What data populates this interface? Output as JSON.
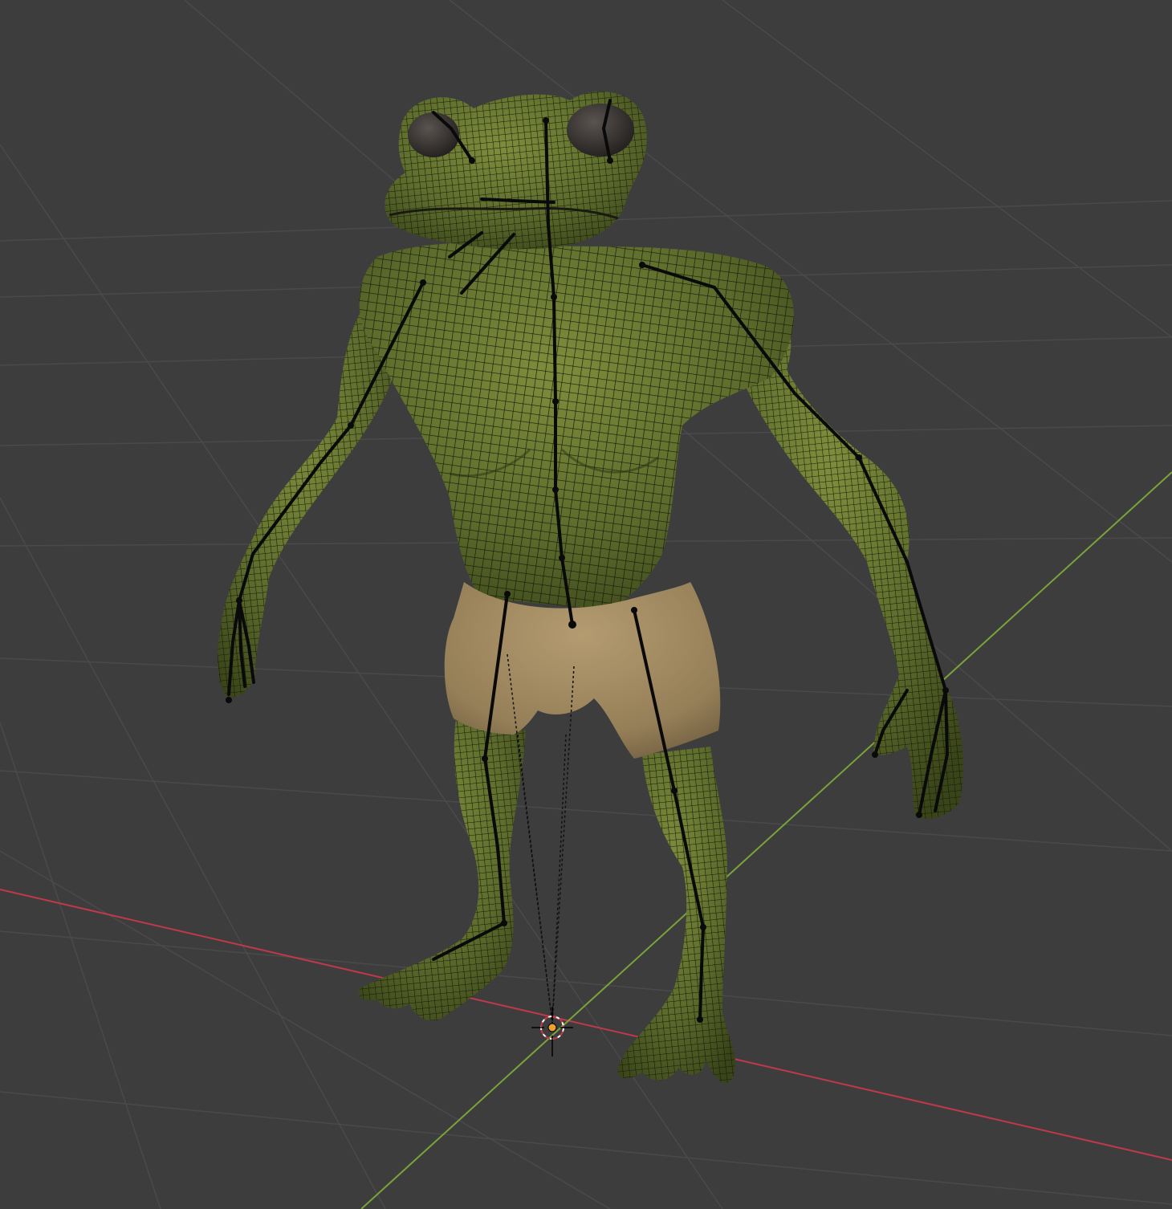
{
  "viewport": {
    "background_color": "#3d3d3d",
    "grid_color": "#4a4a4a",
    "x_axis_color": "#c0394a",
    "y_axis_color": "#7aa33a"
  },
  "model": {
    "skin_color": "#5c6a2c",
    "skin_highlight_color": "#7e8d3c",
    "wire_color": "#141a08",
    "shorts_color": "#a08a62",
    "eye_color": "#3a3634",
    "bone_color": "#0a0a0a"
  },
  "cursor": {
    "icon": "3d-cursor-icon",
    "origin_color": "#f0a030"
  }
}
